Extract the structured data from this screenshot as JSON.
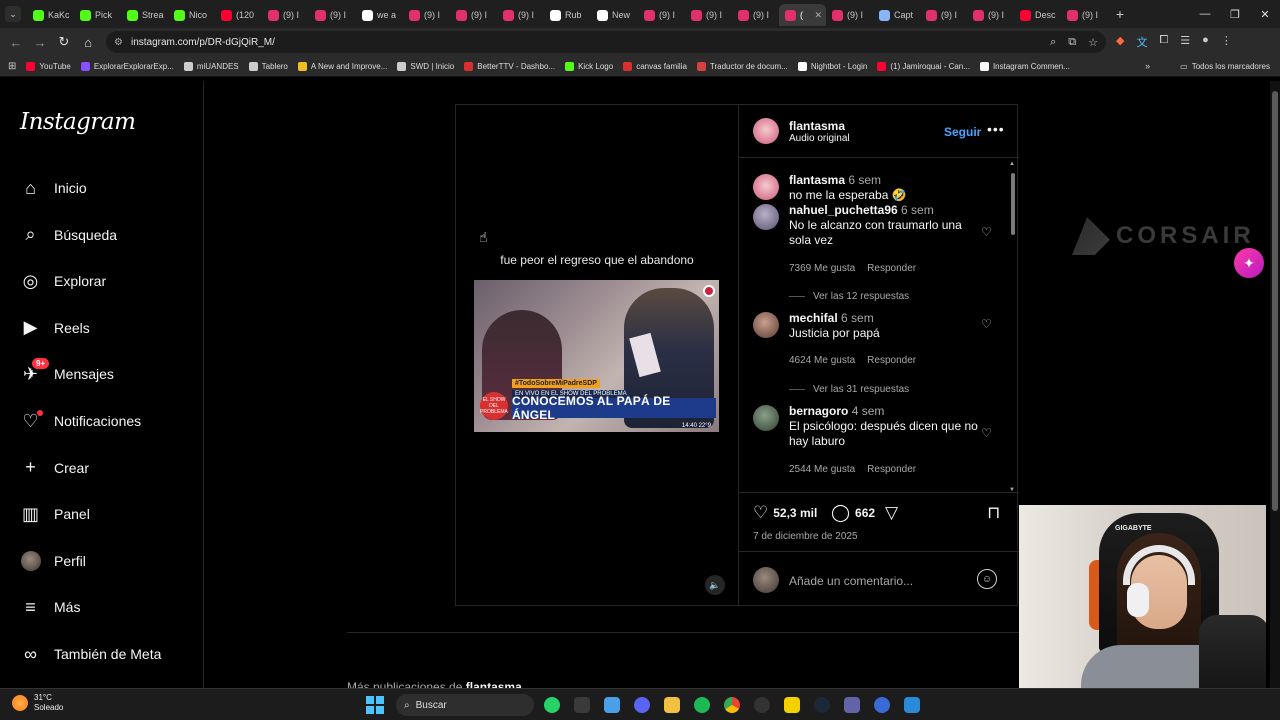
{
  "browser": {
    "tabs": [
      {
        "label": "KaKc",
        "color": "#53fc18"
      },
      {
        "label": "Pick",
        "color": "#53fc18"
      },
      {
        "label": "Strea",
        "color": "#53fc18"
      },
      {
        "label": "Nico",
        "color": "#53fc18"
      },
      {
        "label": "(120",
        "color": "#ff0033"
      },
      {
        "label": "(9) I",
        "color": "#e1306c"
      },
      {
        "label": "(9) I",
        "color": "#e1306c"
      },
      {
        "label": "we a",
        "color": "#ffffff"
      },
      {
        "label": "(9) I",
        "color": "#e1306c"
      },
      {
        "label": "(9) I",
        "color": "#e1306c"
      },
      {
        "label": "(9) I",
        "color": "#e1306c"
      },
      {
        "label": "Rub",
        "color": "#ffffff"
      },
      {
        "label": "New",
        "color": "#ffffff"
      },
      {
        "label": "(9) I",
        "color": "#e1306c"
      },
      {
        "label": "(9) I",
        "color": "#e1306c"
      },
      {
        "label": "(9) I",
        "color": "#e1306c"
      },
      {
        "label": "(",
        "color": "#e1306c",
        "active": true
      },
      {
        "label": "(9) I",
        "color": "#e1306c"
      },
      {
        "label": "Capt",
        "color": "#8ab4f8"
      },
      {
        "label": "(9) I",
        "color": "#e1306c"
      },
      {
        "label": "(9) I",
        "color": "#e1306c"
      },
      {
        "label": "Desc",
        "color": "#ff0033"
      },
      {
        "label": "(9) I",
        "color": "#e1306c"
      }
    ],
    "new_tab_icon": "+",
    "url": "instagram.com/p/DR-dGjQiR_M/",
    "bookmarks": [
      {
        "label": "YouTube",
        "color": "#ff0033"
      },
      {
        "label": "ExplorarExplorarExp...",
        "color": "#8a4fff"
      },
      {
        "label": "miUANDES",
        "color": "#cccccc"
      },
      {
        "label": "Tablero",
        "color": "#cccccc"
      },
      {
        "label": "A New and Improve...",
        "color": "#f0c020"
      },
      {
        "label": "SWD | Inicio",
        "color": "#cccccc"
      },
      {
        "label": "BetterTTV - Dashbo...",
        "color": "#d83030"
      },
      {
        "label": "Kick Logo",
        "color": "#53fc18"
      },
      {
        "label": "canvas familia",
        "color": "#d83030"
      },
      {
        "label": "Traductor de docum...",
        "color": "#d84040"
      },
      {
        "label": "Nightbot - Login",
        "color": "#ffffff"
      },
      {
        "label": "(1) Jamiroquai - Can...",
        "color": "#ff0033"
      },
      {
        "label": "Instagram Commen...",
        "color": "#ffffff"
      }
    ],
    "bookmarks_more": "»",
    "all_bookmarks": "Todos los marcadores"
  },
  "sidebar": {
    "logo": "Instagram",
    "items": [
      {
        "label": "Inicio",
        "icon": "home-icon"
      },
      {
        "label": "Búsqueda",
        "icon": "search-icon"
      },
      {
        "label": "Explorar",
        "icon": "compass-icon"
      },
      {
        "label": "Reels",
        "icon": "reels-icon"
      },
      {
        "label": "Mensajes",
        "icon": "messenger-icon",
        "badge": "9+"
      },
      {
        "label": "Notificaciones",
        "icon": "heart-icon"
      },
      {
        "label": "Crear",
        "icon": "plus-icon"
      },
      {
        "label": "Panel",
        "icon": "dashboard-icon"
      },
      {
        "label": "Perfil",
        "icon": "avatar"
      },
      {
        "label": "Más",
        "icon": "menu-icon"
      },
      {
        "label": "También de Meta",
        "icon": "meta-icon"
      }
    ]
  },
  "post": {
    "media_caption": "fue peor el regreso que el abandono",
    "thumbnail": {
      "hashtag": "#TodoSobreMiPadreSDP",
      "chyron_top": "EN VIVO EN EL SHOW DEL PROBLEMA",
      "chyron": "CONOCEMOS AL PAPÁ DE ÁNGEL",
      "channel_logo": "EL SHOW DEL PROBLEMA",
      "time": "14:40   22°9"
    },
    "header": {
      "username": "flantasma",
      "audio": "Audio original",
      "follow_label": "Seguir",
      "more_icon": "•••"
    },
    "caption": {
      "username": "flantasma",
      "time": "6 sem",
      "text": "no me la esperaba 🤣"
    },
    "comments": [
      {
        "username": "nahuel_puchetta96",
        "time": "6 sem",
        "text": "No le alcanzo con traumarlo una sola vez",
        "likes": "7369 Me gusta",
        "reply": "Responder",
        "replies": "Ver las 12 respuestas"
      },
      {
        "username": "mechifal",
        "time": "6 sem",
        "text": "Justicia por papá",
        "likes": "4624 Me gusta",
        "reply": "Responder",
        "replies": "Ver las 31 respuestas"
      },
      {
        "username": "bernagoro",
        "time": "4 sem",
        "text": "El psicólogo: después dicen que no hay laburo",
        "likes": "2544 Me gusta",
        "reply": "Responder"
      }
    ],
    "actions": {
      "likes": "52,3 mil",
      "comments": "662"
    },
    "date": "7 de diciembre de 2025",
    "add_comment_placeholder": "Añade un comentario..."
  },
  "page": {
    "more_posts_prefix": "Más publicaciones de ",
    "more_posts_user": "flantasma"
  },
  "overlay": {
    "sponsor": "CORSAIR",
    "webcam_brand": "GIGABYTE"
  },
  "taskbar": {
    "temperature": "31°C",
    "condition": "Soleado",
    "search_label": "Buscar"
  }
}
